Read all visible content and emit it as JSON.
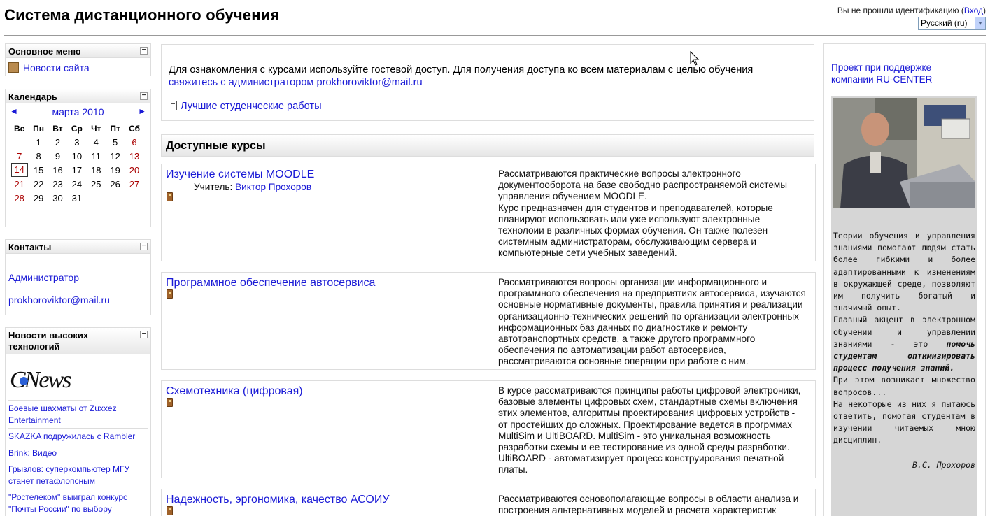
{
  "header": {
    "site_title": "Система дистанционного обучения",
    "login_text": "Вы не прошли идентификацию (",
    "login_link": "Вход",
    "login_close": ")",
    "language": "Русский (ru)"
  },
  "blocks": {
    "main_menu": {
      "title": "Основное меню",
      "item": "Новости сайта"
    },
    "calendar": {
      "title": "Календарь",
      "month": "марта 2010",
      "prev": "◄",
      "next": "►",
      "weekdays": [
        "Вс",
        "Пн",
        "Вт",
        "Ср",
        "Чт",
        "Пт",
        "Сб"
      ],
      "weeks": [
        [
          "",
          "1",
          "2",
          "3",
          "4",
          "5",
          "6"
        ],
        [
          "7",
          "8",
          "9",
          "10",
          "11",
          "12",
          "13"
        ],
        [
          "14",
          "15",
          "16",
          "17",
          "18",
          "19",
          "20"
        ],
        [
          "21",
          "22",
          "23",
          "24",
          "25",
          "26",
          "27"
        ],
        [
          "28",
          "29",
          "30",
          "31",
          "",
          "",
          ""
        ]
      ],
      "today": "14"
    },
    "contacts": {
      "title": "Контакты",
      "admin": "Администратор",
      "email": "prokhoroviktor@mail.ru"
    },
    "news": {
      "title": "Новости высоких технологий",
      "logo": "CNews",
      "items": [
        "Боевые шахматы от Zuxxez Entertainment",
        "SKAZKA подружилась с Rambler",
        "Brink: Видео",
        "Грызлов: суперкомпьютер МГУ станет петафлопсным",
        "\"Ростелеком\" выиграл конкурс \"Почты России\" по выбору"
      ]
    }
  },
  "intro": {
    "text": "Для ознакомления с курсами используйте гостевой доступ. Для получения доступа ко всем материалам с целью обучения",
    "link": "свяжитесь с администратором prokhoroviktor@mail.ru",
    "resource": "Лучшие студенческие работы"
  },
  "courses_heading": "Доступные курсы",
  "courses": [
    {
      "title": "Изучение системы MOODLE",
      "teacher_label": "Учитель:",
      "teacher": "Виктор Прохоров",
      "desc": "Рассматриваются практические вопросы электронного документооборота на базе свободно распространяемой системы управления обучением MOODLE.\nКурс предназначен для студентов и преподавателей, которые планируют использовать или уже используют электронные технолоии в различных формах обучения. Он также полезен системным администраторам, обслуживающим сервера и компьютерные сети учебных заведений."
    },
    {
      "title": "Программное обеспечение автосервиса",
      "desc": "Рассматриваются вопросы организации информационного и программного обеспечения на предприятиях автосервиса, изучаются основные нормативные документы, правила принятия и реализации организационно-технических решений по организации электронных информационных баз данных по диагностике и ремонту автотранспортных средств, а также другого программного обеспечения по автоматизации работ автосервиса, рассматриваются основные операции при работе с ним."
    },
    {
      "title": "Схемотехника (цифровая)",
      "desc": "В курсе рассматриваются принципы работы цифровой электроники, базовые элементы цифровых схем, стандартные схемы включения этих элементов, алгоритмы проектирования цифровых устройств - от простейших до сложных. Проектирование ведется в прогрммах MultiSim и UltiBOARD. MultiSim - это уникальная возможность разработки схемы и ее тестирование из одной среды разработки. UltiBOARD - автоматизирует процесс конструирования печатной платы."
    },
    {
      "title": "Надежность, эргономика, качество АСОИУ",
      "desc": "Рассматриваются основополагающие вопросы в области анализа и построения альтернативных моделей и расчета характеристик"
    }
  ],
  "right_block": {
    "sponsor": "Проект при поддержке компании RU-CENTER",
    "quote_p1": "Теории обучения и управления знаниями помогают людям стать более гибкими и более адаптированными к изменениям в окружающей среде, позволяют им получить богатый и значимый опыт.",
    "quote_p2a": "Главный акцент в электронном обучении и управлении знаниями - это ",
    "quote_p2b": "помочь студентам оптимизировать процесс получения знаний.",
    "quote_p3": "При этом возникает множество вопросов...",
    "quote_p4": "На некоторые из них я пытаюсь ответить, помогая студентам в изучении читаемых мною дисциплин.",
    "signature": "В.С. Прохоров"
  }
}
